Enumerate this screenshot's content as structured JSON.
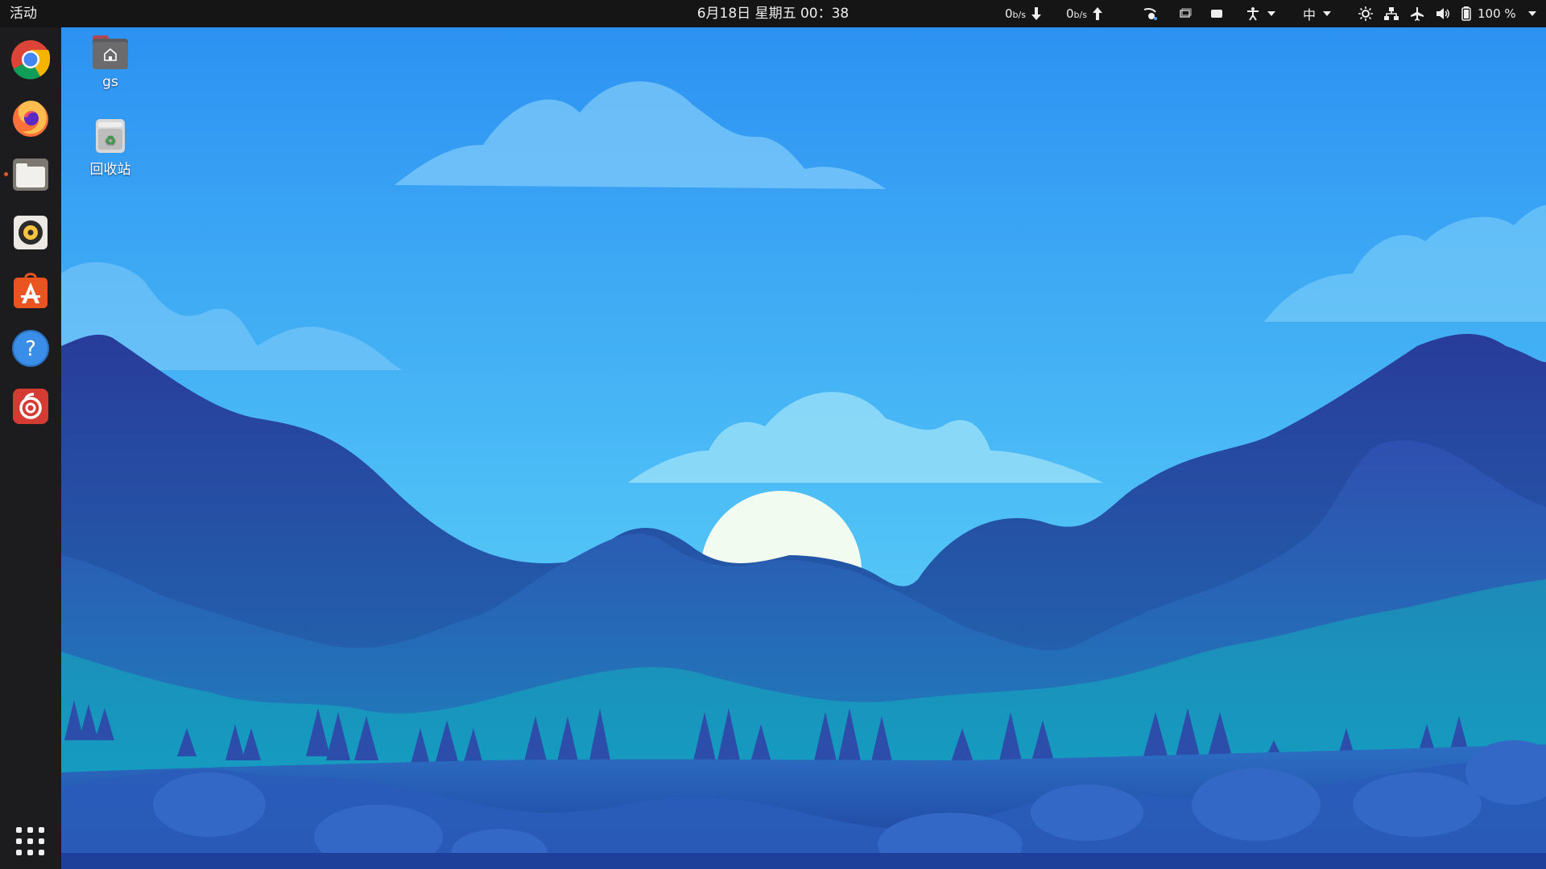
{
  "topbar": {
    "activities_label": "活动",
    "datetime": "6月18日 星期五  00：38",
    "net_down_value": "0",
    "net_down_unit": "b/s",
    "net_up_value": "0",
    "net_up_unit": "b/s",
    "input_method": "中",
    "battery_percent": "100 %"
  },
  "dock": {
    "items": [
      {
        "name": "Google Chrome",
        "icon": "chrome-icon"
      },
      {
        "name": "Firefox",
        "icon": "firefox-icon"
      },
      {
        "name": "Files",
        "icon": "files-icon",
        "running": true
      },
      {
        "name": "Rhythmbox",
        "icon": "rhythmbox-icon"
      },
      {
        "name": "Ubuntu Software",
        "icon": "software-center-icon"
      },
      {
        "name": "Help",
        "icon": "help-icon"
      },
      {
        "name": "NetEase Cloud Music",
        "icon": "netease-music-icon"
      }
    ],
    "show_apps_icon": "app-grid-icon"
  },
  "desktop": {
    "icons": [
      {
        "label": "gs",
        "icon": "home-folder-icon"
      },
      {
        "label": "回收站",
        "icon": "trash-icon"
      }
    ]
  },
  "colors": {
    "topbar_bg": "#151515",
    "dock_bg": "#1c1c1e",
    "sky_top": "#2a8ff2",
    "sky_bottom": "#61d4f5",
    "accent_running": "#e95420"
  }
}
